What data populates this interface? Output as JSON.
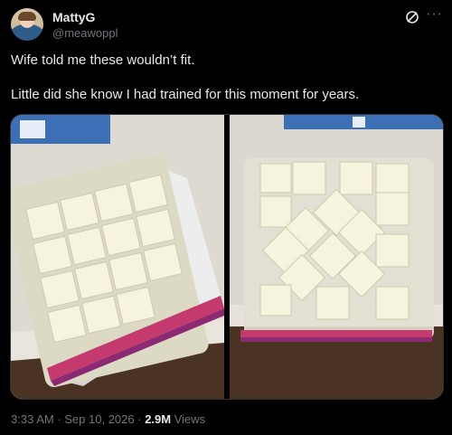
{
  "author": {
    "name": "MattyG",
    "handle": "@meawoppl"
  },
  "tweet": {
    "line1": "Wife told me these wouldn’t fit.",
    "line2": "Little did she know I had trained for this moment for years."
  },
  "media": {
    "photos": [
      {
        "alt": "Bag of ice cubes on counter, left"
      },
      {
        "alt": "Bag of ice cubes on counter, right"
      }
    ]
  },
  "meta": {
    "time": "3:33 AM",
    "separator1": " · ",
    "date": "Sep 10, 2026",
    "separator2": " · ",
    "views_count": "2.9M",
    "views_label": " Views"
  },
  "colors": {
    "background": "#000000",
    "text": "#e7e9ea",
    "muted": "#71767b",
    "border": "#2f3336"
  },
  "icons": {
    "grok": "grok-icon",
    "more": "more-icon"
  }
}
